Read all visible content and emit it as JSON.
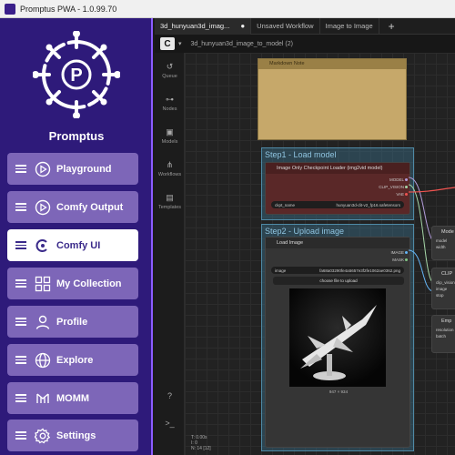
{
  "window": {
    "title": "Promptus PWA - 1.0.99.70"
  },
  "sidebar": {
    "brand": "Promptus",
    "items": [
      {
        "label": "Playground",
        "icon": "play-circle-icon",
        "active": false
      },
      {
        "label": "Comfy Output",
        "icon": "play-circle-icon",
        "active": false
      },
      {
        "label": "Comfy UI",
        "icon": "comfy-logo-icon",
        "active": true
      },
      {
        "label": "My Collection",
        "icon": "grid-icon",
        "active": false
      },
      {
        "label": "Profile",
        "icon": "user-icon",
        "active": false
      },
      {
        "label": "Explore",
        "icon": "globe-icon",
        "active": false
      },
      {
        "label": "MOMM",
        "icon": "momm-icon",
        "active": false
      },
      {
        "label": "Settings",
        "icon": "gear-icon",
        "active": false
      }
    ],
    "colors": {
      "bg": "#2e1a7a",
      "button": "#7d66b8",
      "active": "#ffffff"
    }
  },
  "tabs": [
    {
      "label": "3d_hunyuan3d_imag...",
      "active": true
    },
    {
      "label": "Unsaved Workflow",
      "active": false
    },
    {
      "label": "Image to Image",
      "active": false
    }
  ],
  "subbar": {
    "workflow": "3d_hunyuan3d_image_to_model (2)"
  },
  "tools": [
    {
      "label": "Queue",
      "icon": "history-icon"
    },
    {
      "label": "Nodes",
      "icon": "nodes-icon"
    },
    {
      "label": "Models",
      "icon": "cube-icon"
    },
    {
      "label": "Workflows",
      "icon": "workflow-icon"
    },
    {
      "label": "Templates",
      "icon": "template-icon"
    }
  ],
  "canvas": {
    "note_title": "Markdown Note",
    "step1": {
      "title": "Step1 - Load model",
      "node_title": "Image Only Checkpoint Loader (img2vid model)",
      "outputs": [
        "MODEL",
        "CLIP_VISION",
        "VAE"
      ],
      "widget_label": "ckpt_name",
      "widget_value": "hunyuan3d-dit-v2_fp16.safetensors"
    },
    "step2": {
      "title": "Step2 - Upload image",
      "node_title": "Load Image",
      "outputs": [
        "IMAGE",
        "MASK"
      ],
      "widget_label": "image",
      "widget_value": "fa68a03290fe4a5657e3f2fe1062ae0362.png",
      "upload_button": "choose file to upload",
      "image_size": "947 × 934"
    },
    "side_nodes": [
      {
        "title": "Mode",
        "port": "model"
      },
      {
        "title": "CLIP",
        "port": "clip_vision"
      },
      {
        "title": "Emp",
        "port": "resolution"
      }
    ],
    "side_misc": {
      "width_label": "width",
      "stop_label": "stop",
      "image_label": "image",
      "batch_label": "batch"
    },
    "status": {
      "line1": "T: 0.00s",
      "line2": "I: 0",
      "line3": "N: 14 [12]"
    }
  },
  "bottom_tools": {
    "help": "?",
    "terminal": ">_"
  }
}
